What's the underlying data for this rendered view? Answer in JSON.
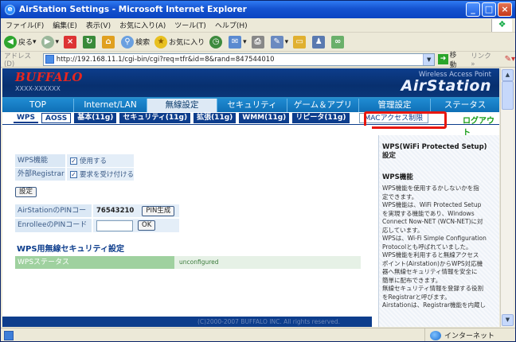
{
  "window": {
    "title": "AirStation Settings - Microsoft Internet Explorer"
  },
  "menu": [
    "ファイル(F)",
    "編集(E)",
    "表示(V)",
    "お気に入り(A)",
    "ツール(T)",
    "ヘルプ(H)"
  ],
  "toolbar": {
    "back": "戻る",
    "search": "検索",
    "favorites": "お気に入り"
  },
  "address": {
    "label": "アドレス(D)",
    "url": "http://192.168.11.1/cgi-bin/cgi?req=tfr&id=8&rand=847544010",
    "go": "移動",
    "links": "リンク"
  },
  "header": {
    "brand": "BUFFALO",
    "model": "XXXX-XXXXXX",
    "wap": "Wireless Access Point",
    "product": "AirStation"
  },
  "nav": [
    {
      "label": "TOP"
    },
    {
      "label": "Internet/LAN"
    },
    {
      "label": "無線設定"
    },
    {
      "label": "セキュリティ"
    },
    {
      "label": "ゲーム＆アプリ"
    },
    {
      "label": "管理設定"
    },
    {
      "label": "ステータス"
    }
  ],
  "subnav": [
    "WPS",
    "AOSS",
    "基本(11g)",
    "セキュリティ(11g)",
    "拡張(11g)",
    "WMM(11g)",
    "リピータ(11g)",
    "MACアクセス制限"
  ],
  "logout": "ログアウト",
  "form": {
    "wps_label": "WPS機能",
    "wps_value": "使用する",
    "ext_label": "外部Registrar",
    "ext_value": "要求を受け付ける",
    "set_button": "設定",
    "pin_label": "AirStationのPINコード",
    "pin_value": "76543210",
    "pin_button": "PIN生成",
    "enrollee_label": "EnrolleeのPINコード",
    "ok_button": "OK"
  },
  "wps_security": {
    "title": "WPS用無線セキュリティ設定",
    "status_label": "WPSステータス",
    "status_value": "unconfigured"
  },
  "footer": "(C)2000-2007 BUFFALO INC. All rights reserved.",
  "help": {
    "heading": "WPS(WiFi Protected Setup)設定",
    "subheading": "WPS機能",
    "lines": [
      "WPS機能を使用するかしないかを指",
      "定できます。",
      "WPS機能は、WiFi Protected Setup",
      "を実現する機能であり、Windows",
      "Connect Now-NET (WCN-NET)に対",
      "応しています。",
      "WPSは、Wi-Fi Simple Configuration",
      "Protocolとも呼ばれていました。",
      "WPS機能を利用すると無線アクセス",
      "ポイント(Airstation)からWPS対応機",
      "器へ無線セキュリティ情報を安全に",
      "簡単に配布できます。",
      "無線セキュリティ情報を登録する役割",
      "をRegistrarと呼びます。",
      "Airstationは、Registrar機能を内蔵し"
    ]
  },
  "statusbar": {
    "zone": "インターネット"
  }
}
